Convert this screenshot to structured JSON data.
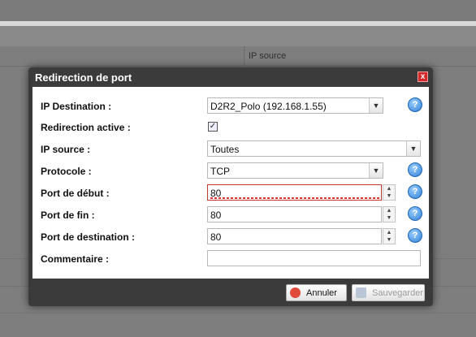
{
  "background": {
    "column_header": "IP source"
  },
  "dialog": {
    "title": "Redirection de port",
    "close_glyph": "x",
    "fields": {
      "ip_destination": {
        "label": "IP Destination :",
        "value": "D2R2_Polo (192.168.1.55)"
      },
      "redirection_active": {
        "label": "Redirection active :",
        "checked": true
      },
      "ip_source": {
        "label": "IP source :",
        "value": "Toutes"
      },
      "protocole": {
        "label": "Protocole :",
        "value": "TCP"
      },
      "port_debut": {
        "label": "Port de début :",
        "value": "80"
      },
      "port_fin": {
        "label": "Port de fin :",
        "value": "80"
      },
      "port_destination": {
        "label": "Port de destination :",
        "value": "80"
      },
      "commentaire": {
        "label": "Commentaire :",
        "value": ""
      }
    },
    "help_glyph": "?",
    "buttons": {
      "cancel": "Annuler",
      "save": "Sauvegarder"
    }
  },
  "colors": {
    "dialog_frame": "#3b3b3b",
    "help_blue": "#2f7fd6",
    "close_red": "#d42a2a",
    "error_red": "#c0392b"
  }
}
